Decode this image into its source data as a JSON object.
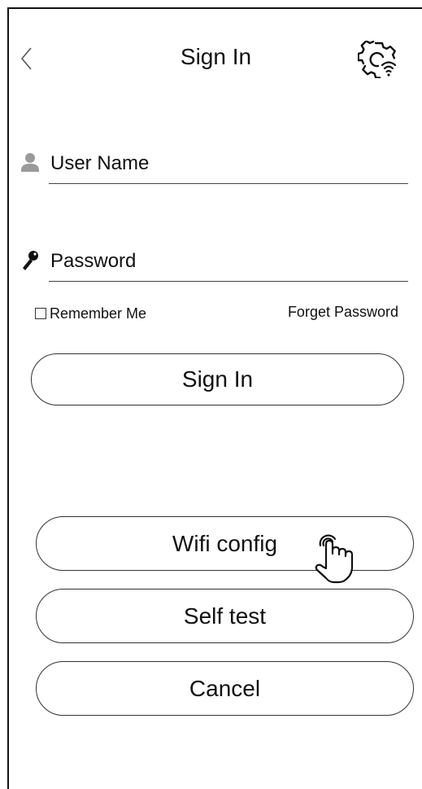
{
  "header": {
    "title": "Sign In",
    "back_icon": "chevron-left-icon",
    "settings_icon": "gear-wifi-icon"
  },
  "form": {
    "username": {
      "placeholder": "User Name",
      "value": "",
      "icon": "user-icon"
    },
    "password": {
      "placeholder": "Password",
      "value": "",
      "icon": "key-icon"
    },
    "remember_label": "Remember Me",
    "remember_checked": false,
    "forget_label": "Forget Password"
  },
  "buttons": {
    "signin": "Sign In",
    "wifi_config": "Wifi config",
    "self_test": "Self test",
    "cancel": "Cancel"
  },
  "pointer_icon": "hand-pointer-icon",
  "colors": {
    "line": "#111111",
    "icon_gray": "#9a9a9a",
    "background": "#ffffff"
  }
}
